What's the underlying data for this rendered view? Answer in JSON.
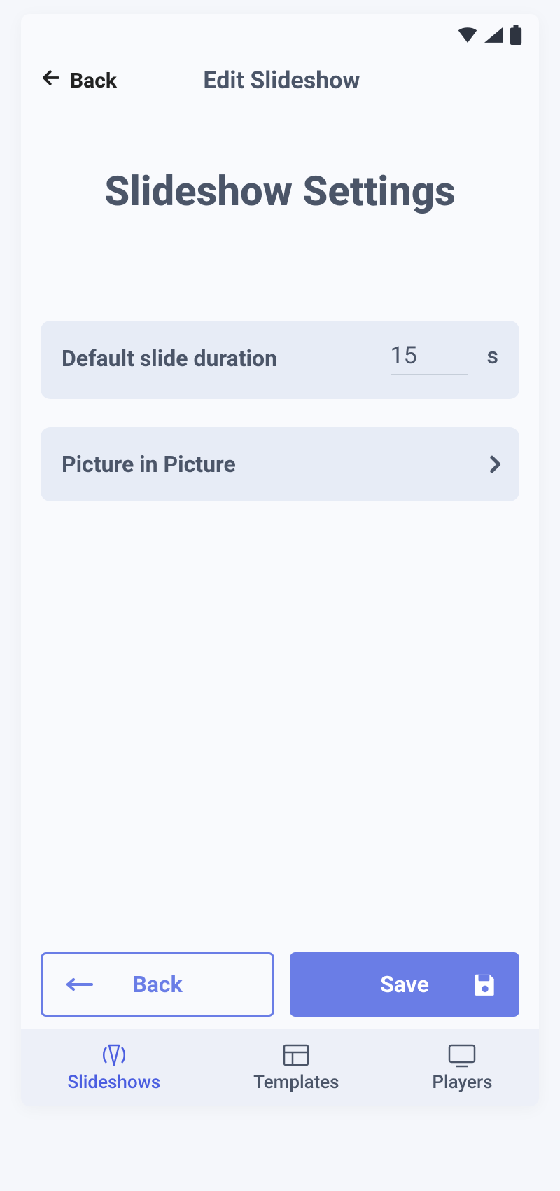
{
  "status": {
    "wifi": "wifi-icon",
    "signal": "signal-icon",
    "battery": "battery-icon"
  },
  "topbar": {
    "back_label": "Back",
    "title": "Edit Slideshow"
  },
  "page": {
    "title": "Slideshow Settings"
  },
  "settings": {
    "duration": {
      "label": "Default slide duration",
      "value": "15",
      "unit": "s"
    },
    "pip": {
      "label": "Picture in Picture"
    }
  },
  "actions": {
    "back_label": "Back",
    "save_label": "Save"
  },
  "nav": {
    "items": [
      {
        "label": "Slideshows",
        "icon": "slideshows-icon",
        "active": true
      },
      {
        "label": "Templates",
        "icon": "templates-icon",
        "active": false
      },
      {
        "label": "Players",
        "icon": "players-icon",
        "active": false
      }
    ]
  },
  "colors": {
    "accent": "#6a7de6",
    "text": "#4b5568",
    "card": "#e7ecf6"
  }
}
